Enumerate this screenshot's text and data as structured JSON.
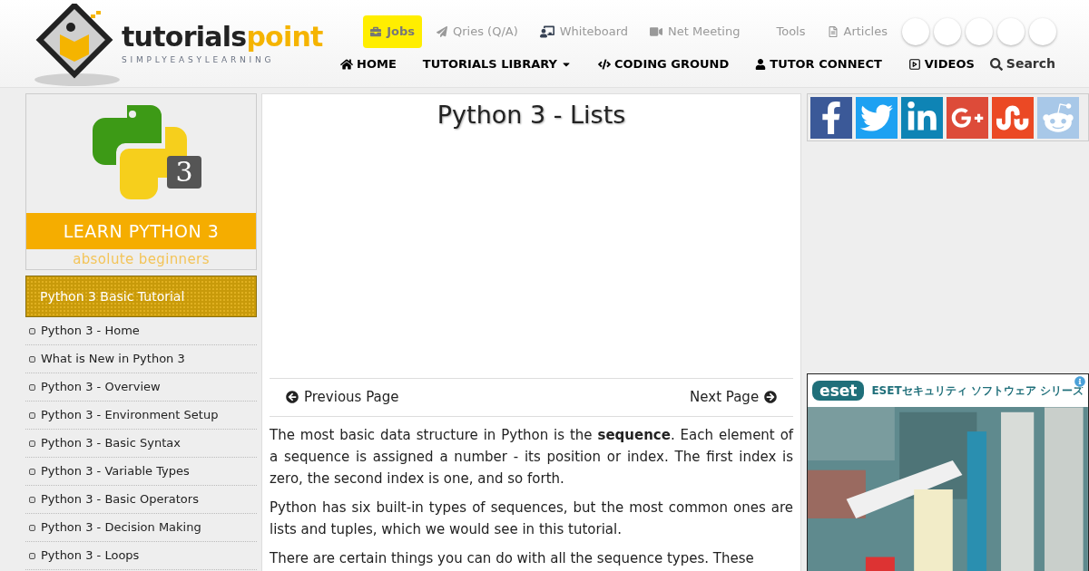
{
  "logo": {
    "name_dark": "tutorials",
    "name_accent": "point",
    "tagline": "SIMPLYEASYLEARNING"
  },
  "top_links": [
    {
      "kind": "jobs",
      "label": "Jobs",
      "selected": true
    },
    {
      "kind": "qa",
      "label": "Qries (Q/A)",
      "selected": false
    },
    {
      "kind": "whiteboard",
      "label": "Whiteboard",
      "selected": false
    },
    {
      "kind": "meeting",
      "label": "Net Meeting",
      "selected": false
    },
    {
      "kind": "tools",
      "label": "Tools",
      "selected": false
    },
    {
      "kind": "articles",
      "label": "Articles",
      "selected": false
    }
  ],
  "main_nav": [
    {
      "kind": "home",
      "label": "HOME"
    },
    {
      "kind": "library",
      "label": "TUTORIALS LIBRARY"
    },
    {
      "kind": "code",
      "label": "CODING GROUND"
    },
    {
      "kind": "tutor",
      "label": "TUTOR CONNECT"
    },
    {
      "kind": "videos",
      "label": "VIDEOS"
    },
    {
      "kind": "search",
      "label": "Search"
    }
  ],
  "banner": {
    "badge": "3",
    "title": "LEARN PYTHON 3",
    "subtitle": "absolute beginners"
  },
  "sidebar": {
    "heading": "Python 3 Basic Tutorial",
    "items": [
      "Python 3 - Home",
      "What is New in Python 3",
      "Python 3 - Overview",
      "Python 3 - Environment Setup",
      "Python 3 - Basic Syntax",
      "Python 3 - Variable Types",
      "Python 3 - Basic Operators",
      "Python 3 - Decision Making",
      "Python 3 - Loops"
    ]
  },
  "article": {
    "title": "Python 3 - Lists",
    "previous": "Previous Page",
    "next": "Next Page",
    "paragraphs": [
      "The most basic data structure in Python is the **sequence**. Each element of a sequence is assigned a number - its position or index. The first index is zero, the second index is one, and so forth.",
      "Python has six built-in types of sequences, but the most common ones are lists and tuples, which we would see in this tutorial.",
      "There are certain things you can do with all the sequence types. These"
    ]
  },
  "share": [
    {
      "kind": "facebook",
      "color": "#3b5998"
    },
    {
      "kind": "twitter",
      "color": "#1da1f2"
    },
    {
      "kind": "linkedin",
      "color": "#0e84b5"
    },
    {
      "kind": "googleplus",
      "color": "#dd4b39"
    },
    {
      "kind": "stumbleupon",
      "color": "#eb4924"
    },
    {
      "kind": "reddit",
      "color": "#a8c8e8"
    }
  ],
  "ad": {
    "brand": "eset",
    "headline": "ESETセキュリティ ソフトウェア シリーズ",
    "kind": "picture"
  }
}
